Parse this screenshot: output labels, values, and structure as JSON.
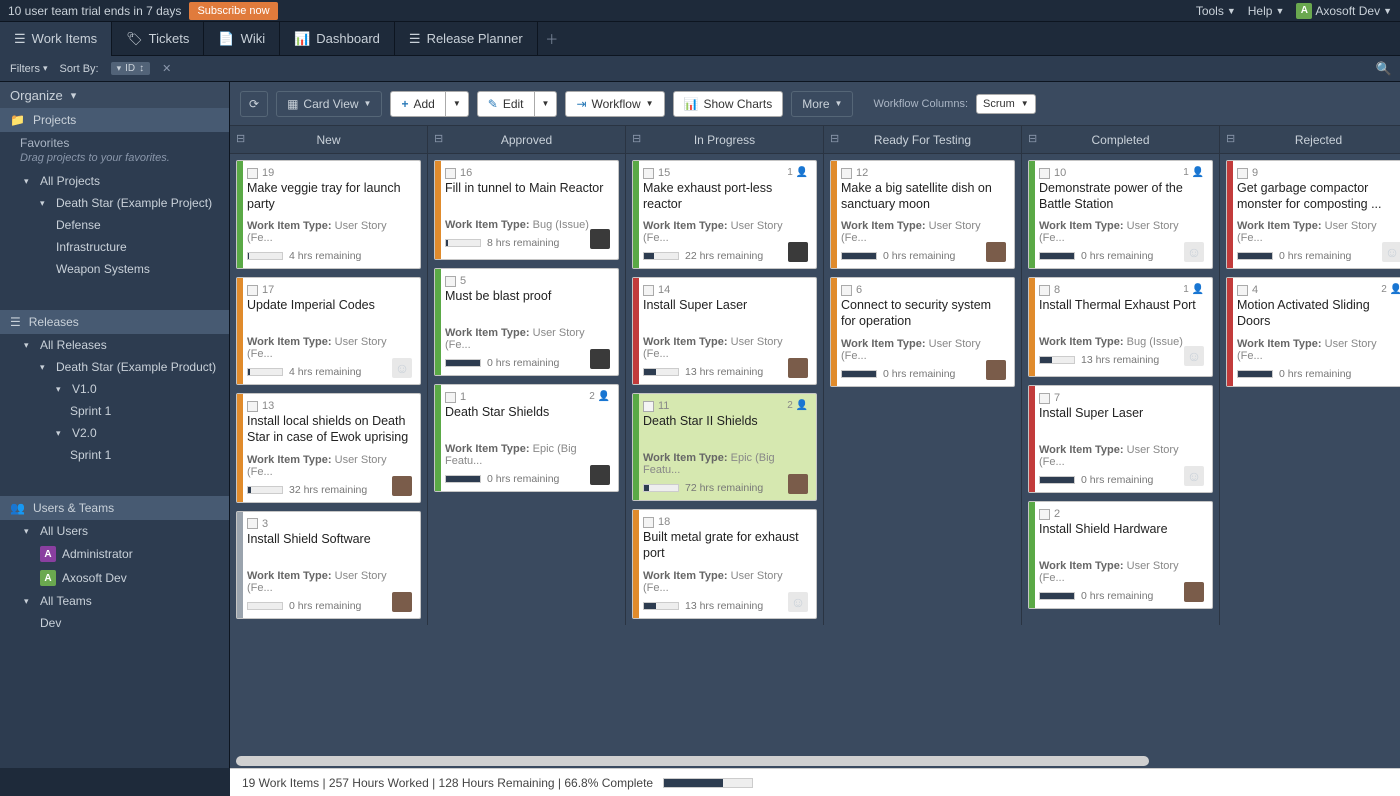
{
  "topbar": {
    "trial_msg": "10 user team trial ends in 7 days",
    "subscribe": "Subscribe now",
    "tools": "Tools",
    "help": "Help",
    "user_initial": "A",
    "user_name": "Axosoft Dev"
  },
  "nav": {
    "work_items": "Work Items",
    "tickets": "Tickets",
    "wiki": "Wiki",
    "dashboard": "Dashboard",
    "release_planner": "Release Planner"
  },
  "filterbar": {
    "filters": "Filters",
    "sort_by": "Sort By:",
    "sort_chip": "ID"
  },
  "sidebar": {
    "organize": "Organize",
    "projects": "Projects",
    "favorites": "Favorites",
    "fav_hint": "Drag projects to your favorites.",
    "all_projects": "All Projects",
    "p_deathstar": "Death Star (Example Project)",
    "p_defense": "Defense",
    "p_infra": "Infrastructure",
    "p_weapon": "Weapon Systems",
    "releases": "Releases",
    "all_releases": "All Releases",
    "r_deathstar": "Death Star (Example Product)",
    "r_v10": "V1.0",
    "r_sprint1a": "Sprint 1",
    "r_v20": "V2.0",
    "r_sprint1b": "Sprint 1",
    "users_teams": "Users & Teams",
    "all_users": "All Users",
    "u_admin": "Administrator",
    "u_axo": "Axosoft Dev",
    "all_teams": "All Teams",
    "t_dev": "Dev"
  },
  "toolbar": {
    "card_view": "Card View",
    "add": "Add",
    "edit": "Edit",
    "workflow": "Workflow",
    "show_charts": "Show Charts",
    "more": "More",
    "wf_label": "Workflow Columns:",
    "wf_value": "Scrum"
  },
  "columns": [
    "New",
    "Approved",
    "In Progress",
    "Ready For Testing",
    "Completed",
    "Rejected"
  ],
  "type_label": "Work Item Type:",
  "type_story": "User Story (Fe…",
  "type_story2": "User Story (Fe...",
  "type_bug": "Bug (Issue)",
  "type_epic": "Epic (Big Featu...",
  "remain_suffix": "hrs remaining",
  "cards": {
    "new": [
      {
        "id": "19",
        "title": "Make veggie tray for launch party",
        "type": "story",
        "remain": "4",
        "progress": 2,
        "stripe": "green",
        "avatar": ""
      },
      {
        "id": "17",
        "title": "Update Imperial Codes",
        "type": "story",
        "remain": "4",
        "progress": 5,
        "stripe": "orange",
        "avatar": "troop"
      },
      {
        "id": "13",
        "title": "Install local shields on Death Star in case of Ewok uprising",
        "type": "story",
        "remain": "32",
        "progress": 8,
        "stripe": "orange",
        "avatar": "p1"
      },
      {
        "id": "3",
        "title": "Install Shield Software",
        "type": "story",
        "remain": "0",
        "progress": 0,
        "stripe": "gray",
        "avatar": "p1"
      }
    ],
    "approved": [
      {
        "id": "16",
        "title": "Fill in tunnel to Main Reactor",
        "type": "bug",
        "remain": "8",
        "progress": 5,
        "stripe": "orange",
        "avatar": "p2"
      },
      {
        "id": "5",
        "title": "Must be blast proof",
        "type": "story",
        "remain": "0",
        "progress": 100,
        "stripe": "green",
        "avatar": "p2"
      },
      {
        "id": "1",
        "title": "Death Star Shields",
        "type": "epic",
        "remain": "0",
        "progress": 100,
        "stripe": "green",
        "avatar": "p2",
        "badge": "2"
      }
    ],
    "inprogress": [
      {
        "id": "15",
        "title": "Make exhaust port-less reactor",
        "type": "story",
        "remain": "22",
        "progress": 30,
        "stripe": "green",
        "avatar": "p2",
        "badge": "1"
      },
      {
        "id": "14",
        "title": "Install Super Laser",
        "type": "story",
        "remain": "13",
        "progress": 35,
        "stripe": "red",
        "avatar": "p1"
      },
      {
        "id": "11",
        "title": "Death Star II Shields",
        "type": "epic",
        "remain": "72",
        "progress": 15,
        "stripe": "green",
        "avatar": "p1",
        "badge": "2",
        "hl": true
      },
      {
        "id": "18",
        "title": "Built metal grate for exhaust port",
        "type": "story",
        "remain": "13",
        "progress": 35,
        "stripe": "orange",
        "avatar": "troop"
      }
    ],
    "ready": [
      {
        "id": "12",
        "title": "Make a big satellite dish on sanctuary moon",
        "type": "story",
        "remain": "0",
        "progress": 100,
        "stripe": "orange",
        "avatar": "p1"
      },
      {
        "id": "6",
        "title": "Connect to security system for operation",
        "type": "story",
        "remain": "0",
        "progress": 100,
        "stripe": "orange",
        "avatar": "p1"
      }
    ],
    "completed": [
      {
        "id": "10",
        "title": "Demonstrate power of the Battle Station",
        "type": "story",
        "remain": "0",
        "progress": 100,
        "stripe": "green",
        "avatar": "troop",
        "badge": "1"
      },
      {
        "id": "8",
        "title": "Install Thermal Exhaust Port",
        "type": "bug",
        "remain": "13",
        "progress": 35,
        "stripe": "orange",
        "avatar": "troop",
        "badge": "1"
      },
      {
        "id": "7",
        "title": "Install Super Laser",
        "type": "story",
        "remain": "0",
        "progress": 100,
        "stripe": "red",
        "avatar": "troop"
      },
      {
        "id": "2",
        "title": "Install Shield Hardware",
        "type": "story",
        "remain": "0",
        "progress": 100,
        "stripe": "green",
        "avatar": "p1"
      }
    ],
    "rejected": [
      {
        "id": "9",
        "title": "Get garbage compactor monster for composting ...",
        "type": "story",
        "remain": "0",
        "progress": 100,
        "stripe": "red",
        "avatar": "troop"
      },
      {
        "id": "4",
        "title": "Motion Activated Sliding Doors",
        "type": "story",
        "remain": "0",
        "progress": 100,
        "stripe": "red",
        "avatar": "",
        "badge": "2"
      }
    ]
  },
  "status": {
    "text": "19 Work Items | 257 Hours Worked | 128 Hours Remaining | 66.8% Complete"
  }
}
